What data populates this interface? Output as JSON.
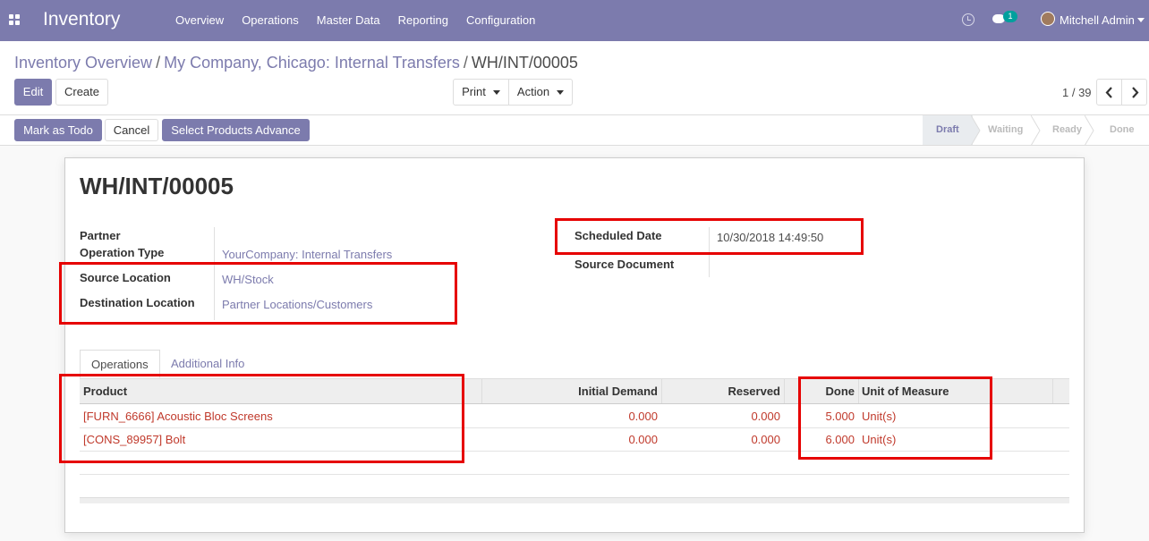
{
  "navbar": {
    "app_title": "Inventory",
    "menu": [
      "Overview",
      "Operations",
      "Master Data",
      "Reporting",
      "Configuration"
    ],
    "chat_count": "1",
    "user_name": "Mitchell Admin"
  },
  "breadcrumb": {
    "items": [
      "Inventory Overview",
      "My Company, Chicago: Internal Transfers"
    ],
    "separator": "/",
    "current": "WH/INT/00005"
  },
  "buttons": {
    "edit": "Edit",
    "create": "Create",
    "print": "Print",
    "action": "Action",
    "mark_todo": "Mark as Todo",
    "cancel": "Cancel",
    "select_products": "Select Products Advance"
  },
  "pager": {
    "value": "1 / 39"
  },
  "stages": [
    "Draft",
    "Waiting",
    "Ready",
    "Done"
  ],
  "record": {
    "name": "WH/INT/00005",
    "fields": {
      "partner_label": "Partner",
      "operation_type_label": "Operation Type",
      "operation_type": "YourCompany: Internal Transfers",
      "source_location_label": "Source Location",
      "source_location": "WH/Stock",
      "destination_location_label": "Destination Location",
      "destination_location": "Partner Locations/Customers",
      "scheduled_date_label": "Scheduled Date",
      "scheduled_date": "10/30/2018 14:49:50",
      "source_document_label": "Source Document"
    }
  },
  "tabs": [
    "Operations",
    "Additional Info"
  ],
  "table": {
    "columns": [
      "Product",
      "Initial Demand",
      "Reserved",
      "Done",
      "Unit of Measure"
    ],
    "rows": [
      {
        "product": "[FURN_6666] Acoustic Bloc Screens",
        "initial_demand": "0.000",
        "reserved": "0.000",
        "done": "5.000",
        "uom": "Unit(s)"
      },
      {
        "product": "[CONS_89957] Bolt",
        "initial_demand": "0.000",
        "reserved": "0.000",
        "done": "6.000",
        "uom": "Unit(s)"
      }
    ]
  },
  "colors": {
    "brand": "#7c7bad",
    "highlight": "#e60000",
    "row_text": "#c0392b"
  }
}
